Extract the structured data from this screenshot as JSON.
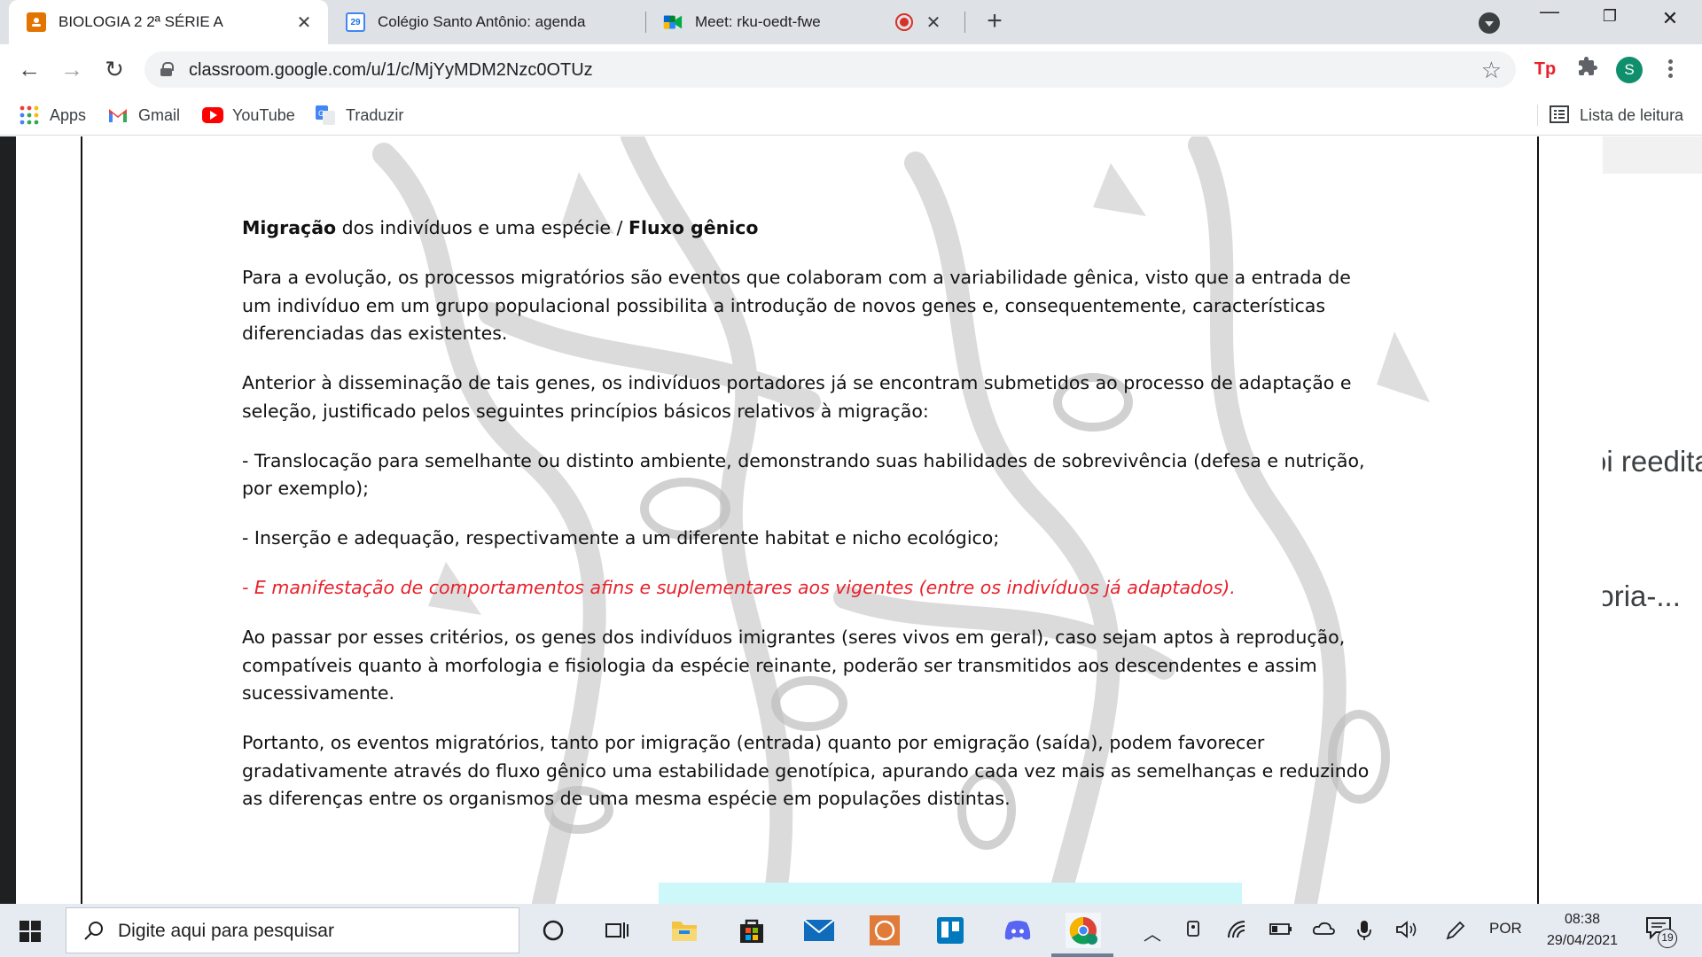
{
  "tabs": [
    {
      "title": "BIOLOGIA 2 2ª SÉRIE A",
      "icon": "google-classroom-icon",
      "active": true
    },
    {
      "title": "Colégio Santo Antônio: agenda",
      "icon": "google-calendar-icon",
      "active": false,
      "calendar_day": "29"
    },
    {
      "title": "Meet: rku-oedt-fwe",
      "icon": "google-meet-icon",
      "active": false,
      "recording": true
    }
  ],
  "toolbar": {
    "url": "classroom.google.com/u/1/c/MjYyMDM2Nzc0OTUz",
    "profile_initial": "S",
    "extension_label": "Tp"
  },
  "bookmarks": [
    {
      "label": "Apps",
      "icon": "apps-grid-icon"
    },
    {
      "label": "Gmail",
      "icon": "gmail-icon"
    },
    {
      "label": "YouTube",
      "icon": "youtube-icon"
    },
    {
      "label": "Traduzir",
      "icon": "google-translate-icon"
    }
  ],
  "reading_list": "Lista de leitura",
  "side_panel_fragments": [
    "oi reedita",
    "eoria-..."
  ],
  "document": {
    "heading": {
      "bold1": "Migração",
      "normal": " dos indivíduos e uma espécie / ",
      "bold2": "Fluxo gênico"
    },
    "paragraphs": [
      "Para a evolução, os processos migratórios são eventos que colaboram com a variabilidade gênica, visto que a entrada de um indivíduo em um grupo populacional possibilita a introdução de novos genes e, consequentemente, características diferenciadas das existentes.",
      "Anterior à disseminação de tais genes, os indivíduos portadores já se encontram submetidos ao processo de adaptação e seleção, justificado pelos seguintes princípios básicos relativos à migração:",
      "- Translocação para semelhante ou distinto ambiente, demonstrando suas habilidades de sobrevivência (defesa e nutrição, por exemplo);",
      "- Inserção e adequação, respectivamente a um diferente habitat e nicho ecológico;"
    ],
    "highlight": "- E manifestação de comportamentos afins e suplementares aos vigentes (entre os indivíduos já adaptados).",
    "closing": [
      "Ao passar por esses critérios, os genes dos indivíduos imigrantes (seres vivos em geral), caso sejam aptos à reprodução, compatíveis quanto à morfologia e fisiologia da espécie reinante, poderão ser transmitidos aos descendentes e assim sucessivamente.",
      "Portanto, os eventos migratórios, tanto por imigração (entrada) quanto por emigração (saída), podem favorecer gradativamente através do fluxo gênico uma estabilidade genotípica, apurando cada vez mais as semelhanças e reduzindo as diferenças entre os organismos de uma mesma espécie em populações distintas."
    ]
  },
  "taskbar": {
    "search_placeholder": "Digite aqui para pesquisar",
    "language": "POR",
    "time": "08:38",
    "date": "29/04/2021",
    "notification_count": "19",
    "pinned": [
      "cortana-icon",
      "task-view-icon",
      "file-explorer-icon",
      "microsoft-store-icon",
      "mail-icon",
      "whatsapp-icon",
      "trello-icon",
      "discord-icon",
      "chrome-icon"
    ]
  },
  "colors": {
    "highlight_text": "#e8212b",
    "tab_strip": "#dee1e6",
    "taskbar": "#e6ebf2"
  }
}
